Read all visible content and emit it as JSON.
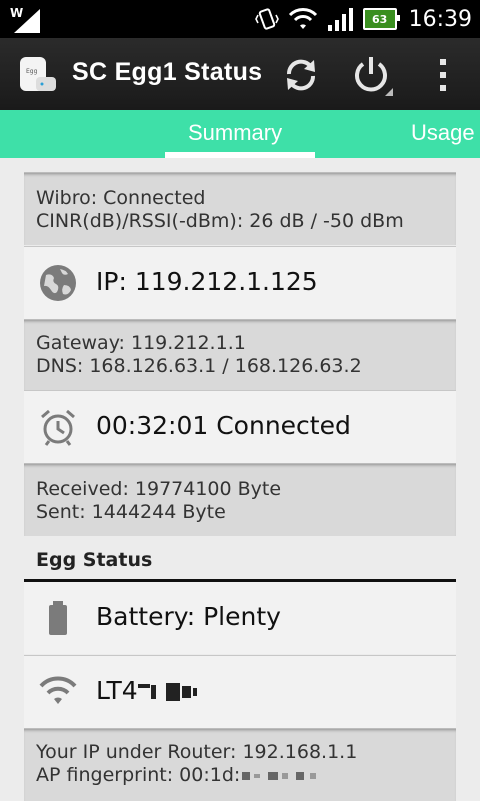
{
  "status_bar": {
    "time": "16:39",
    "battery": "63"
  },
  "app": {
    "title": "SC Egg1 Status"
  },
  "actions": {
    "refresh_icon": "refresh-icon",
    "power_icon": "power-icon",
    "overflow_icon": "overflow-menu-icon"
  },
  "tabs": [
    {
      "label": "Summary",
      "selected": true
    },
    {
      "label": "Usage",
      "selected": false
    }
  ],
  "summary": {
    "wibro_status": "Wibro: Connected",
    "signal": "CINR(dB)/RSSI(-dBm): 26 dB / -50 dBm",
    "ip": "IP: 119.212.1.125",
    "gateway": "Gateway: 119.212.1.1",
    "dns": "DNS: 168.126.63.1 / 168.126.63.2",
    "connection_time": "00:32:01 Connected",
    "received": "Received: 19774100 Byte",
    "sent": "Sent: 1444244 Byte"
  },
  "egg_status": {
    "header": "Egg Status",
    "battery": "Battery: Plenty",
    "ssid_prefix": "LT4",
    "router_ip": "Your IP under Router: 192.168.1.1",
    "ap_fingerprint_prefix": "AP fingerprint: 00:1d:"
  }
}
